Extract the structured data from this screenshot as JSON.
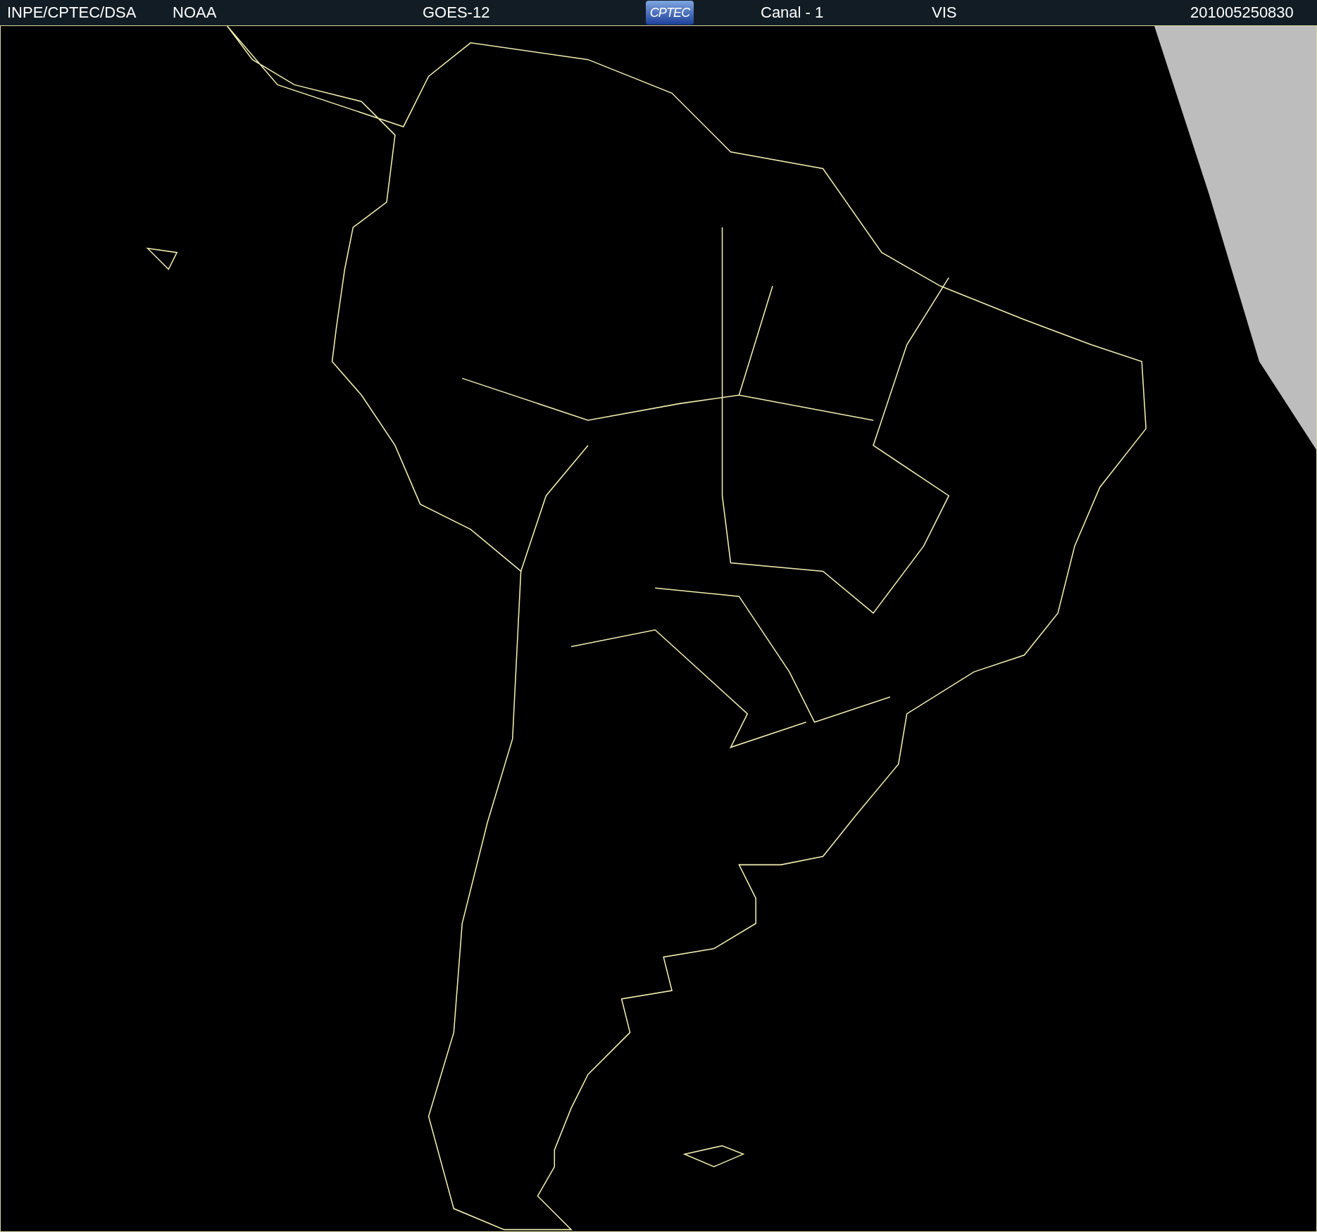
{
  "header": {
    "items": [
      {
        "kind": "text",
        "text": "INPE/CPTEC/DSA"
      },
      {
        "kind": "text",
        "text": "NOAA"
      },
      {
        "kind": "text",
        "text": "GOES-12"
      },
      {
        "kind": "logo",
        "text": "CPTEC"
      },
      {
        "kind": "text",
        "text": "Canal - 1"
      },
      {
        "kind": "text",
        "text": "VIS"
      },
      {
        "kind": "text",
        "text": "201005250830"
      }
    ]
  }
}
